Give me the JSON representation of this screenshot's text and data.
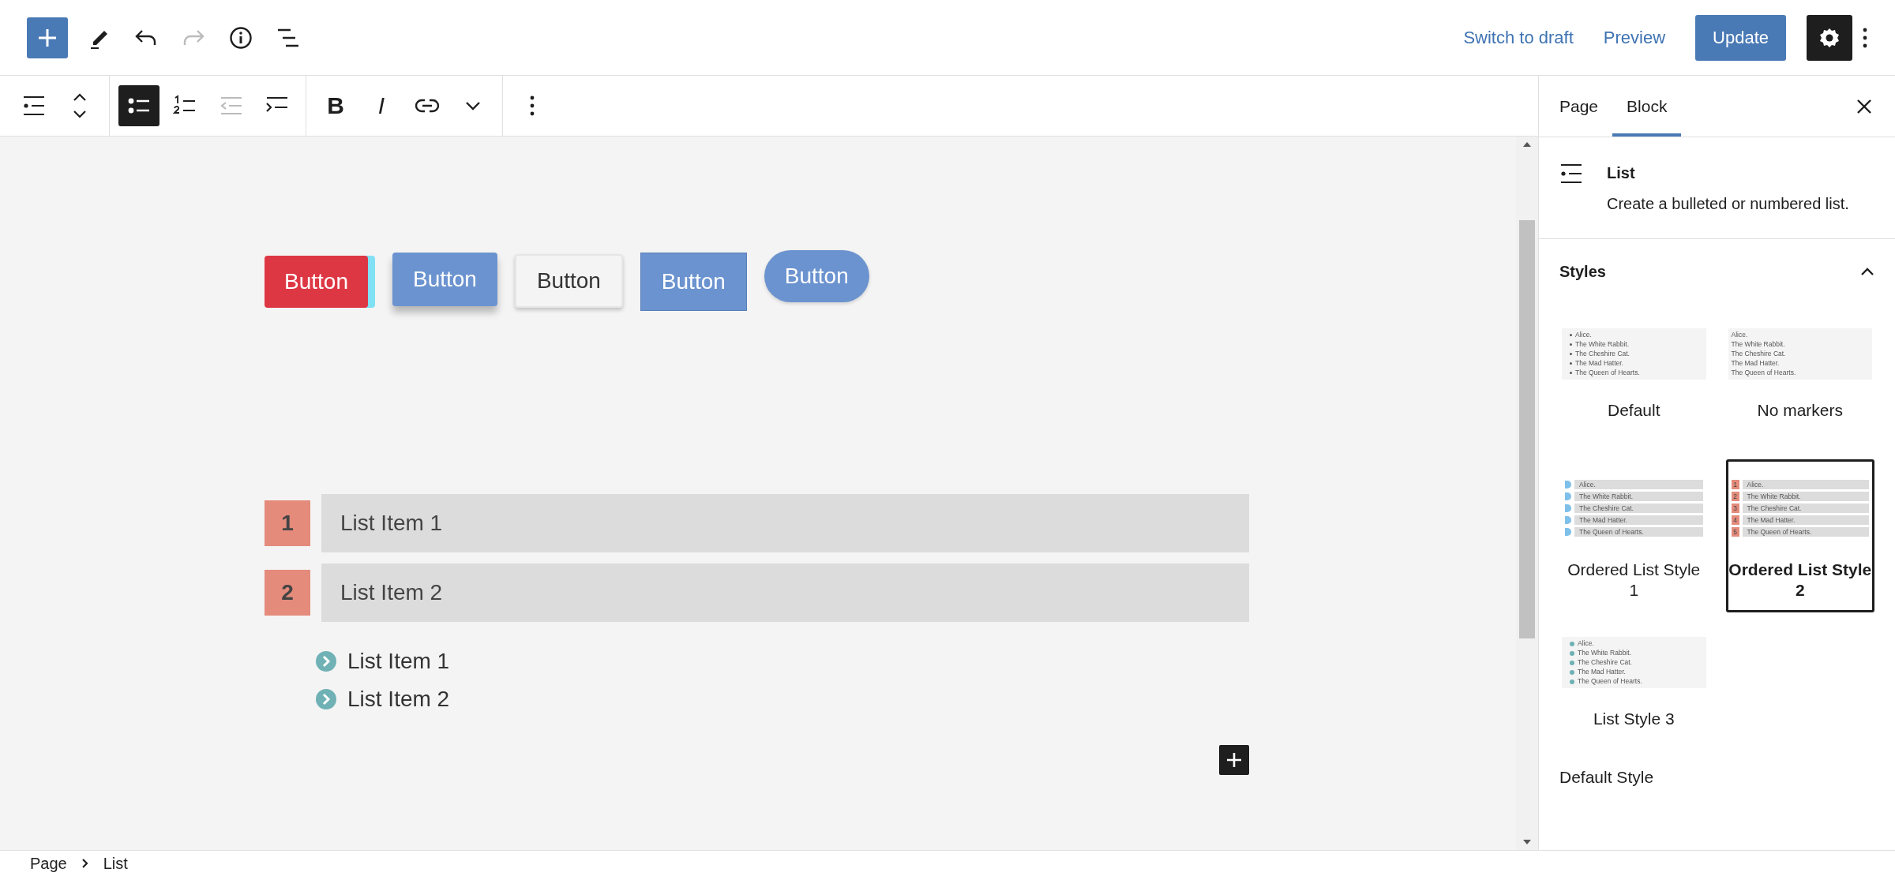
{
  "header": {
    "tools": [
      {
        "kind": "inserter",
        "disabled": false
      },
      {
        "kind": "edit",
        "disabled": false
      },
      {
        "kind": "undo",
        "disabled": false
      },
      {
        "kind": "redo",
        "disabled": true
      },
      {
        "kind": "details",
        "disabled": false
      },
      {
        "kind": "outline",
        "disabled": false
      }
    ],
    "links": [
      "Switch to draft",
      "Preview"
    ],
    "primary": "Update",
    "settings": {
      "selected": true
    }
  },
  "block_toolbar": [
    {
      "kind": "list-block",
      "selected": false,
      "disabled": false
    },
    {
      "kind": "move",
      "selected": false,
      "disabled": false
    },
    {
      "kind": "bullets",
      "selected": true,
      "disabled": false
    },
    {
      "kind": "numbered",
      "selected": false,
      "disabled": false
    },
    {
      "kind": "outdent",
      "selected": false,
      "disabled": true
    },
    {
      "kind": "indent",
      "selected": false,
      "disabled": false
    },
    {
      "kind": "bold",
      "label": "B",
      "selected": false,
      "disabled": false
    },
    {
      "kind": "italic",
      "label": "I",
      "selected": false,
      "disabled": false
    },
    {
      "kind": "link",
      "selected": false,
      "disabled": false
    },
    {
      "kind": "more",
      "selected": false,
      "disabled": false
    },
    {
      "kind": "options",
      "selected": false,
      "disabled": false
    }
  ],
  "canvas": {
    "buttons": [
      {
        "label": "Button",
        "kind": "shadowed"
      },
      {
        "label": "Button",
        "kind": "raised"
      },
      {
        "label": "Button",
        "kind": "light"
      },
      {
        "label": "Button",
        "kind": "flat"
      },
      {
        "label": "Button",
        "kind": "pill"
      }
    ],
    "ordered_list": [
      {
        "number": "1",
        "label": "List Item 1"
      },
      {
        "number": "2",
        "label": "List Item 2"
      }
    ],
    "chevron_list": [
      "List Item 1",
      "List Item 2"
    ]
  },
  "breadcrumb": [
    "Page",
    "List"
  ],
  "sidebar": {
    "tabs": [
      {
        "label": "Page",
        "selected": false
      },
      {
        "label": "Block",
        "selected": true
      }
    ],
    "block": {
      "title": "List",
      "description": "Create a bulleted or numbered list."
    },
    "styles": {
      "title": "Styles",
      "expanded": true,
      "options": [
        {
          "label": "Default",
          "kind": "bullets",
          "selected": false,
          "preview": [
            "Alice.",
            "The White Rabbit.",
            "The Cheshire Cat.",
            "The Mad Hatter.",
            "The Queen of Hearts."
          ]
        },
        {
          "label": "No markers",
          "kind": "plain",
          "selected": false,
          "preview": [
            "Alice.",
            "The White Rabbit.",
            "The Cheshire Cat.",
            "The Mad Hatter.",
            "The Queen of Hearts."
          ]
        },
        {
          "label": "Ordered List Style 1",
          "kind": "circles",
          "selected": false,
          "preview": [
            "Alice.",
            "The White Rabbit.",
            "The Cheshire Cat.",
            "The Mad Hatter.",
            "The Queen of Hearts."
          ]
        },
        {
          "label": "Ordered List Style 2",
          "kind": "numbered",
          "selected": true,
          "numbers": [
            "1",
            "2",
            "3",
            "4",
            "5"
          ],
          "preview": [
            "Alice.",
            "The White Rabbit.",
            "The Cheshire Cat.",
            "The Mad Hatter.",
            "The Queen of Hearts."
          ]
        },
        {
          "label": "List Style 3",
          "kind": "chevrons",
          "selected": false,
          "preview": [
            "Alice.",
            "The White Rabbit.",
            "The Cheshire Cat.",
            "The Mad Hatter.",
            "The Queen of Hearts."
          ]
        }
      ],
      "next_heading": "Default Style"
    }
  }
}
